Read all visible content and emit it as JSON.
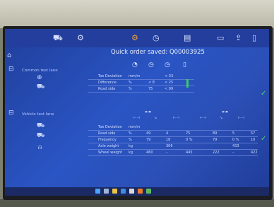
{
  "topbar": {
    "icons": [
      "car-icon",
      "settings-icon",
      "save-icon",
      "clock-icon",
      "printer-icon",
      "note-icon",
      "share-icon",
      "menu-icon"
    ],
    "status": "Quick order saved: Q00003925"
  },
  "section1": {
    "label": "Common test lane",
    "headers": [
      "dial-icon",
      "stopwatch-icon",
      "stopwatch-icon",
      "battery-icon"
    ],
    "rows": [
      {
        "label": "Toe Deviation",
        "unit": "mm/m",
        "v1": "",
        "v2": "< 33"
      },
      {
        "label": "Difference",
        "unit": "%",
        "v1": "< 8",
        "v2": "< 25"
      },
      {
        "label": "Road side",
        "unit": "%",
        "v1": "75",
        "v2": "< 99"
      }
    ]
  },
  "section2": {
    "label": "Vehicle test lane",
    "headers": [
      "axle-icon",
      "axle-icon"
    ],
    "row_toe": {
      "label": "Toe Deviation",
      "unit": "mm/m"
    },
    "subheaders": [
      "⊢⊣",
      "↘",
      "⊢⊣",
      "⊢⊣",
      "↘",
      "⊢⊣"
    ],
    "rows": [
      {
        "label": "Road side",
        "unit": "%",
        "vals": [
          "49",
          "4",
          "75",
          "89",
          "5",
          "57"
        ]
      },
      {
        "label": "Frequency",
        "unit": "%",
        "vals": [
          "79",
          "18",
          "0 %",
          "79",
          "0 %",
          "10"
        ]
      },
      {
        "label": "Axle weight",
        "unit": "kg",
        "vals": [
          "",
          "306",
          "",
          "",
          "433",
          ""
        ]
      },
      {
        "label": "Wheel weight",
        "unit": "kg",
        "vals": [
          "460",
          "–",
          "445",
          "222",
          "–",
          "422"
        ]
      }
    ]
  },
  "colors": {
    "accent": "#f0a234",
    "screen": "#2a55c4",
    "ok": "#3ac96a"
  }
}
